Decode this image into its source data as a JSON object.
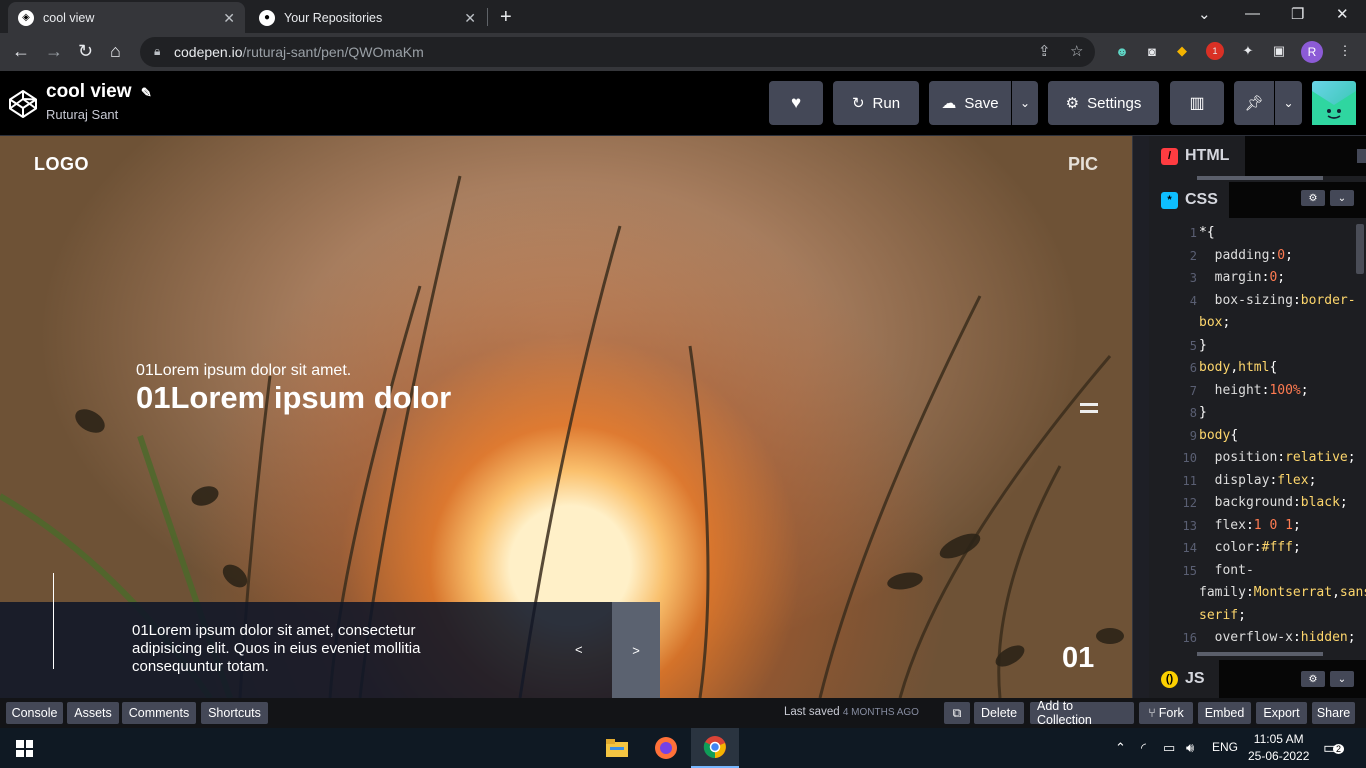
{
  "browser": {
    "tabs": [
      {
        "title": "cool view",
        "active": true
      },
      {
        "title": "Your Repositories",
        "active": false
      }
    ],
    "url_host": "codepen.io",
    "url_path": "/ruturaj-sant/pen/QWOmaKm",
    "profile_initial": "R",
    "extension_badge": "1"
  },
  "codepen": {
    "pen_title": "cool view",
    "author": "Ruturaj Sant",
    "buttons": {
      "run": "Run",
      "save": "Save",
      "settings": "Settings"
    }
  },
  "preview": {
    "logo": "LOGO",
    "pic": "PIC",
    "subtitle": "01Lorem ipsum dolor sit amet.",
    "heading": "01Lorem ipsum dolor",
    "description": "01Lorem ipsum dolor sit amet, consectetur adipisicing elit. Quos in eius eveniet mollitia consequuntur totam.",
    "prev": "<",
    "next": ">",
    "slide_number": "01"
  },
  "editor": {
    "html_tab": "HTML",
    "css_tab": "CSS",
    "js_tab": "JS",
    "line_numbers": [
      "1",
      "2",
      "3",
      "4",
      "",
      "5",
      "6",
      "7",
      "8",
      "9",
      "10",
      "11",
      "12",
      "13",
      "14",
      "15",
      "",
      "",
      "16"
    ]
  },
  "footer": {
    "left_buttons": [
      "Console",
      "Assets",
      "Comments",
      "Shortcuts"
    ],
    "last_saved_label": "Last saved",
    "last_saved_time": "4 MONTHS AGO",
    "right_buttons": [
      "Delete",
      "Add to Collection",
      "Fork",
      "Embed",
      "Export",
      "Share"
    ]
  },
  "taskbar": {
    "language": "ENG",
    "time": "11:05 AM",
    "date": "25-06-2022",
    "notifications": "2"
  },
  "colors": {
    "codepen_button": "#444857",
    "html_badge": "#ff3c41",
    "css_badge": "#0ebeff",
    "js_badge": "#fcd000",
    "css_property": "#ddd",
    "css_value": "#ff7b51",
    "css_keyword": "#a6e22e"
  }
}
